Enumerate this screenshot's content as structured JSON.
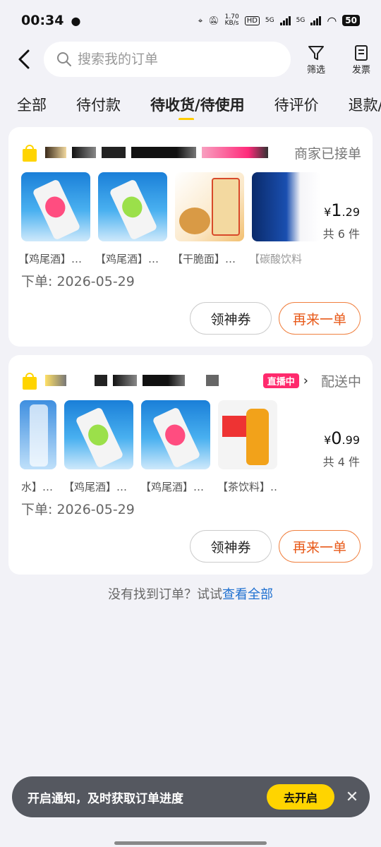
{
  "status_bar": {
    "time": "00:34",
    "net_speed": "1.70\nKB/s",
    "network1": "5G",
    "network2": "5G",
    "battery": "50"
  },
  "header": {
    "search_placeholder": "搜索我的订单",
    "filter_label": "筛选",
    "invoice_label": "发票"
  },
  "tabs": [
    {
      "label": "全部"
    },
    {
      "label": "待付款"
    },
    {
      "label": "待收货/待使用",
      "active": true
    },
    {
      "label": "待评价"
    },
    {
      "label": "退款/"
    }
  ],
  "orders": [
    {
      "status": "商家已接单",
      "price_symbol": "¥",
      "price_int": "1",
      "price_dec": ".29",
      "count": "共 6 件",
      "item_names": [
        "【鸡尾酒】…",
        "【鸡尾酒】…",
        "【干脆面】…",
        "【碳酸饮料"
      ],
      "date": "下单: 2026-05-29",
      "coupon_btn": "领神券",
      "reorder_btn": "再来一单"
    },
    {
      "status": "配送中",
      "live_badge": "直播中",
      "price_symbol": "¥",
      "price_int": "0",
      "price_dec": ".99",
      "count": "共 4 件",
      "item_names": [
        "水】…",
        "【鸡尾酒】…",
        "【鸡尾酒】…",
        "【茶饮料】…"
      ],
      "date": "下单: 2026-05-29",
      "coupon_btn": "领神券",
      "reorder_btn": "再来一单"
    }
  ],
  "footer": {
    "not_found_text": "没有找到订单？试试",
    "view_all_link": "查看全部"
  },
  "toast": {
    "message": "开启通知，及时获取订单进度",
    "action": "去开启"
  },
  "colors": {
    "accent_yellow": "#ffd400",
    "orange": "#e85a1a",
    "link_blue": "#1e70d0",
    "live_pink": "#ff2a6d"
  }
}
